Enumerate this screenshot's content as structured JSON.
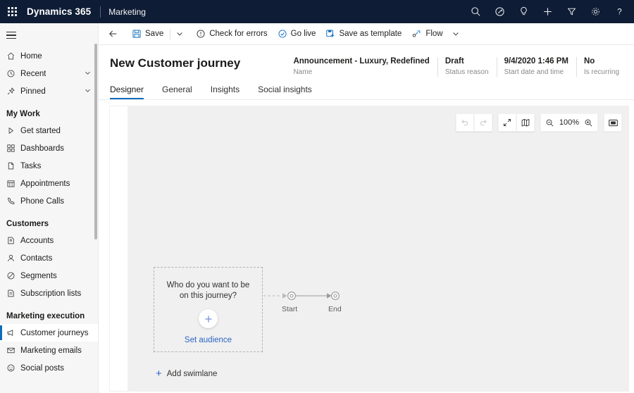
{
  "topnav": {
    "waffle_label": "app-launcher",
    "brand": "Dynamics 365",
    "app_name": "Marketing",
    "icons": [
      {
        "name": "search-icon",
        "label": "Search"
      },
      {
        "name": "relevance-search-icon",
        "label": "Relevance"
      },
      {
        "name": "lightbulb-icon",
        "label": "Assistant"
      },
      {
        "name": "plus-icon",
        "label": "Quick create"
      },
      {
        "name": "filter-icon",
        "label": "Filter"
      },
      {
        "name": "gear-icon",
        "label": "Settings"
      },
      {
        "name": "help-icon",
        "label": "Help"
      }
    ]
  },
  "sidebar": {
    "hamburger_label": "Site map",
    "items": [
      {
        "label": "Home",
        "icon": "home-icon",
        "chevron": false,
        "selected": false
      },
      {
        "label": "Recent",
        "icon": "clock-icon",
        "chevron": true,
        "selected": false
      },
      {
        "label": "Pinned",
        "icon": "pin-icon",
        "chevron": true,
        "selected": false
      }
    ],
    "groups": [
      {
        "title": "My Work",
        "items": [
          {
            "label": "Get started",
            "icon": "play-icon",
            "selected": false
          },
          {
            "label": "Dashboards",
            "icon": "dashboard-icon",
            "selected": false
          },
          {
            "label": "Tasks",
            "icon": "task-icon",
            "selected": false
          },
          {
            "label": "Appointments",
            "icon": "calendar-icon",
            "selected": false
          },
          {
            "label": "Phone Calls",
            "icon": "phone-icon",
            "selected": false
          }
        ]
      },
      {
        "title": "Customers",
        "items": [
          {
            "label": "Accounts",
            "icon": "account-icon",
            "selected": false
          },
          {
            "label": "Contacts",
            "icon": "contact-icon",
            "selected": false
          },
          {
            "label": "Segments",
            "icon": "segment-icon",
            "selected": false
          },
          {
            "label": "Subscription lists",
            "icon": "subscription-list-icon",
            "selected": false
          }
        ]
      },
      {
        "title": "Marketing execution",
        "items": [
          {
            "label": "Customer journeys",
            "icon": "megaphone-icon",
            "selected": true
          },
          {
            "label": "Marketing emails",
            "icon": "envelope-icon",
            "selected": false
          },
          {
            "label": "Social posts",
            "icon": "smiley-icon",
            "selected": false
          }
        ]
      }
    ]
  },
  "commandbar": {
    "back_label": "Back",
    "save_label": "Save",
    "save_chevron_label": "Save options",
    "check_errors_label": "Check for errors",
    "go_live_label": "Go live",
    "save_template_label": "Save as template",
    "flow_label": "Flow",
    "flow_chevron_label": "Flow options"
  },
  "record": {
    "title": "New Customer journey",
    "fields": [
      {
        "value": "Announcement - Luxury, Redefined",
        "label": "Name"
      },
      {
        "value": "Draft",
        "label": "Status reason"
      },
      {
        "value": "9/4/2020 1:46 PM",
        "label": "Start date and time"
      },
      {
        "value": "No",
        "label": "Is recurring"
      }
    ]
  },
  "tabs": [
    {
      "label": "Designer",
      "active": true
    },
    {
      "label": "General",
      "active": false
    },
    {
      "label": "Insights",
      "active": false
    },
    {
      "label": "Social insights",
      "active": false
    }
  ],
  "designer": {
    "toolbar": {
      "undo_label": "Undo",
      "redo_label": "Redo",
      "expand_label": "Expand",
      "minimap_label": "Minimap",
      "zoom_out_label": "Zoom out",
      "zoom_level": "100%",
      "zoom_in_label": "Zoom in",
      "fit_label": "Fit to screen"
    },
    "card": {
      "question": "Who do you want to be on this journey?",
      "add_label": "Add audience",
      "link": "Set audience"
    },
    "flow": {
      "start_label": "Start",
      "end_label": "End"
    },
    "add_swimlane": {
      "plus": "+",
      "label": "Add swimlane"
    }
  },
  "colors": {
    "nav_bg": "#0e1c35",
    "accent": "#0f6cbd",
    "link": "#2b65c4",
    "canvas": "#f0f0f0",
    "sidebar_bg": "#f6f6f6"
  }
}
